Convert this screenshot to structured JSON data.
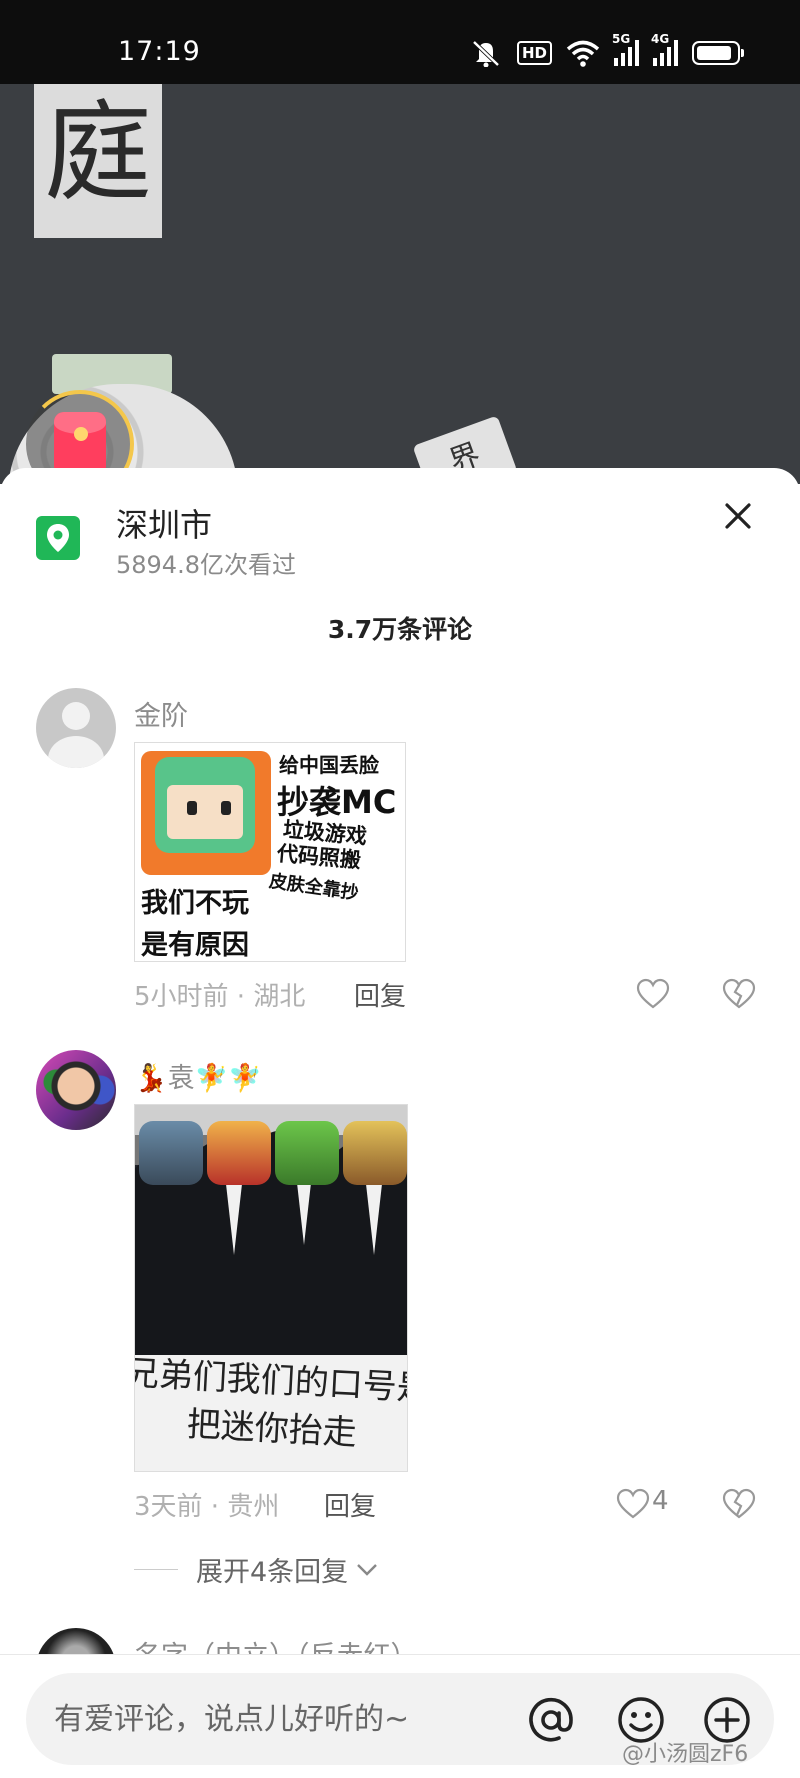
{
  "status_bar": {
    "time": "17:19",
    "hd_label": "HD",
    "sim1_label": "5G",
    "sim2_label": "4G",
    "battery_level": 0.9
  },
  "video": {
    "paper_char": "庭",
    "sign_text": "界"
  },
  "location": {
    "name": "深圳市",
    "views": "5894.8亿次看过"
  },
  "comments_header": {
    "count_label": "3.7万条评论"
  },
  "comments": [
    {
      "username": "金阶",
      "meme": {
        "top": "给中国丢脸",
        "big": "抄袭MC",
        "line2": "垃圾游戏",
        "line3": "代码照搬",
        "line4": "皮肤全靠抄",
        "bottom1": "我们不玩",
        "bottom2": "是有原因"
      },
      "meta": "5小时前 · 湖北",
      "reply": "回复",
      "likes": ""
    },
    {
      "username": "💃袁🧚🧚",
      "meme": {
        "caption1": "兄弟们我们的口号是",
        "caption2": "把迷你抬走"
      },
      "meta": "3天前 · 贵州",
      "reply": "回复",
      "likes": "4",
      "expand": "展开4条回复"
    },
    {
      "username": "名字（中立）（反赤红）"
    }
  ],
  "input": {
    "placeholder": "有爱评论，说点儿好听的~"
  },
  "watermark": "@小汤圆zF6",
  "colors": {
    "location_green": "#20b757",
    "redpacket": "#ff3e5e",
    "ring": "#f4c74b"
  }
}
